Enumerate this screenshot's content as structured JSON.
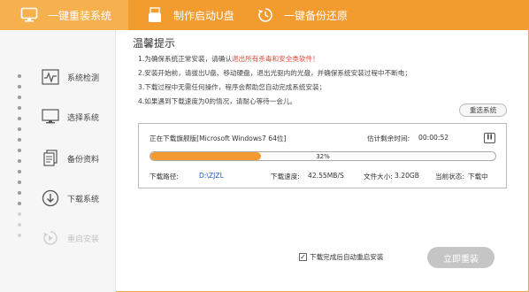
{
  "topbar": {
    "accent_color": "#f29b2e",
    "tabs": [
      {
        "label": "一键重装系统",
        "icon": "monitor-icon"
      },
      {
        "label": "制作启动U盘",
        "icon": "usb-icon"
      },
      {
        "label": "一键备份还原",
        "icon": "restore-icon"
      }
    ]
  },
  "sidebar": {
    "items": [
      {
        "label": "系统检测",
        "icon": "waveform-icon"
      },
      {
        "label": "选择系统",
        "icon": "monitor-icon"
      },
      {
        "label": "备份资料",
        "icon": "files-icon"
      },
      {
        "label": "下载系统",
        "icon": "download-icon"
      },
      {
        "label": "重启安装",
        "icon": "reboot-icon"
      }
    ]
  },
  "main": {
    "title": "温馨提示",
    "tip1_a": "1.为确保系统正常安装，请确认",
    "tip1_red": "退出所有杀毒和安全类软件！",
    "tip2": "2.安装开始前，请拔出U盘、移动硬盘，退出光驱内的光盘，并确保系统安装过程中不断电；",
    "tip3": "3.下载过程中无需任何操作，程序会帮助您自动完成系统安装；",
    "tip4": "4.如果遇到下载速度为0的情况，请耐心等待一会儿。",
    "reselect_label": "重选系统",
    "download": {
      "status_text": "正在下载旗舰版[Microsoft Windows7 64位]",
      "remaining_label": "估计剩余时间:",
      "remaining_value": "00:00:52",
      "progress_percent": 32,
      "progress_label": "32%",
      "path_label": "下载路径:",
      "path_value": "D:\\ZJZL",
      "speed_label": "下载速度:",
      "speed_value": "42.55MB/S",
      "size_label": "文件大小:",
      "size_value": "3.20GB",
      "state_label": "当前状态:",
      "state_value": "下载中"
    },
    "auto_reboot_label": "下载完成后自动重启安装",
    "auto_reboot_checked": true,
    "install_label": "立即重装"
  }
}
